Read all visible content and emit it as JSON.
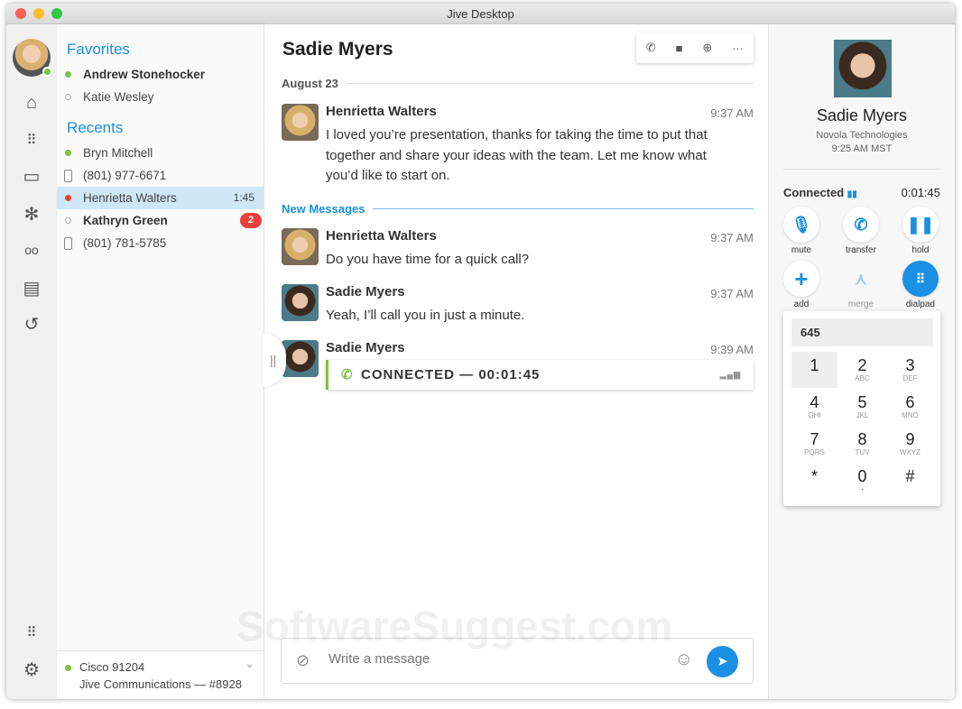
{
  "window": {
    "title": "Jive Desktop"
  },
  "favorites": {
    "heading": "Favorites",
    "items": [
      {
        "name": "Andrew Stonehocker",
        "status": "online"
      },
      {
        "name": "Katie Wesley",
        "status": "offline"
      }
    ]
  },
  "recents": {
    "heading": "Recents",
    "items": [
      {
        "name": "Bryn Mitchell",
        "status": "online"
      },
      {
        "name": "(801) 977-6671",
        "status": "phone"
      },
      {
        "name": "Henrietta Walters",
        "status": "busy",
        "meta": "1:45"
      },
      {
        "name": "Kathryn Green",
        "status": "offline",
        "badge": "2"
      },
      {
        "name": "(801) 781-5785",
        "status": "phone"
      }
    ]
  },
  "footer": {
    "line1": "Cisco 91204",
    "line2": "Jive Communications — #8928"
  },
  "chat": {
    "title": "Sadie Myers",
    "date_divider": "August 23",
    "new_divider": "New Messages",
    "messages": [
      {
        "name": "Henrietta Walters",
        "time": "9:37 AM",
        "text": "I loved you’re presentation, thanks for taking the time to put that together and share your ideas with the team. Let me know what you’d like to start on."
      },
      {
        "name": "Henrietta Walters",
        "time": "9:37 AM",
        "text": "Do you have time for a quick call?"
      },
      {
        "name": "Sadie Myers",
        "time": "9:37 AM",
        "text": "Yeah, I’ll call you in just a minute."
      },
      {
        "name": "Sadie Myers",
        "time": "9:39 AM",
        "text": "CONNECTED — 00:01:45"
      }
    ],
    "compose_placeholder": "Write a message"
  },
  "contact": {
    "name": "Sadie Myers",
    "company": "Novola Technologies",
    "local_time": "9:25 AM MST",
    "status": "Connected",
    "duration": "0:01:45"
  },
  "call_buttons": [
    "mute",
    "transfer",
    "hold",
    "add",
    "merge",
    "dialpad"
  ],
  "dialpad": {
    "value": "645",
    "keys": [
      [
        "1",
        ""
      ],
      [
        "2",
        "ABC"
      ],
      [
        "3",
        "DEF"
      ],
      [
        "4",
        "GHI"
      ],
      [
        "5",
        "JKL"
      ],
      [
        "6",
        "MNO"
      ],
      [
        "7",
        "PQRS"
      ],
      [
        "8",
        "TUV"
      ],
      [
        "9",
        "WXYZ"
      ],
      [
        "*",
        ""
      ],
      [
        "0",
        "+"
      ],
      [
        "#",
        ""
      ]
    ]
  },
  "watermark": "SoftwareSuggest.com",
  "colors": {
    "accent": "#1a8fe3",
    "online": "#7dc242",
    "busy": "#e8403a"
  }
}
